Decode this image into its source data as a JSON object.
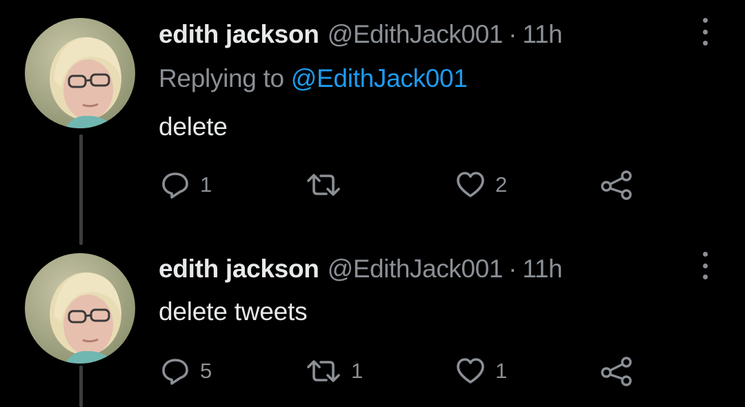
{
  "colors": {
    "background": "#000000",
    "text_primary": "#e7e9ea",
    "text_secondary": "#8b9096",
    "link": "#1d9bf0",
    "thread_line": "#3a3d40"
  },
  "tweets": [
    {
      "author": {
        "display_name": "edith jackson",
        "handle": "@EdithJack001",
        "separator": "·",
        "time": "11h"
      },
      "replying_to": {
        "prefix": "Replying to",
        "mention": "@EdithJack001"
      },
      "text": "delete",
      "actions": {
        "reply": {
          "icon": "reply-icon",
          "count": "1"
        },
        "retweet": {
          "icon": "retweet-icon",
          "count": ""
        },
        "like": {
          "icon": "heart-icon",
          "count": "2"
        },
        "share": {
          "icon": "share-icon"
        }
      },
      "more_icon": "more-options-icon"
    },
    {
      "author": {
        "display_name": "edith jackson",
        "handle": "@EdithJack001",
        "separator": "·",
        "time": "11h"
      },
      "text": "delete tweets",
      "actions": {
        "reply": {
          "icon": "reply-icon",
          "count": "5"
        },
        "retweet": {
          "icon": "retweet-icon",
          "count": "1"
        },
        "like": {
          "icon": "heart-icon",
          "count": "1"
        },
        "share": {
          "icon": "share-icon"
        }
      },
      "more_icon": "more-options-icon"
    }
  ]
}
